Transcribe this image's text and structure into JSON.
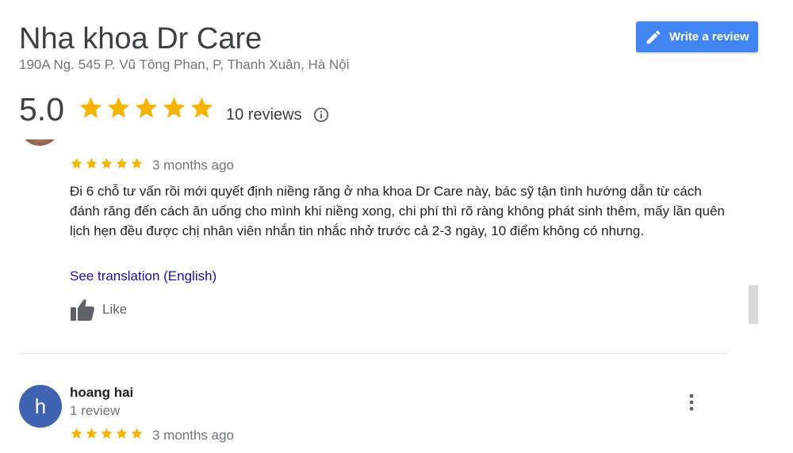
{
  "place": {
    "name": "Nha khoa Dr Care",
    "address": "190A Ng. 545 P. Vũ Tông Phan, P, Thanh Xuân, Hà Nội"
  },
  "write_review": {
    "label": "Write a review"
  },
  "summary": {
    "rating": "5.0",
    "stars": 5,
    "reviews_label": "10 reviews"
  },
  "reviews": [
    {
      "stars": 5,
      "date": "3 months ago",
      "text": "Đi 6 chỗ tư vấn rồi mới quyết định niềng răng ở nha khoa Dr Care này, bác sỹ tận tình hướng dẫn từ cách đánh răng đến cách ăn uống cho mình khi niềng xong, chi phí thì rõ ràng không phát sinh thêm, mấy lần quên lịch hẹn đều được chị nhân viên nhắn tin nhắc nhở trước cả 2-3 ngày, 10 điểm không có nhưng.",
      "translate_label": "See translation (English)",
      "like_label": "Like"
    },
    {
      "author": "hoang hai",
      "avatar_letter": "h",
      "author_meta": "1 review",
      "stars": 5,
      "date": "3 months ago"
    }
  ],
  "colors": {
    "star": "#f4b400",
    "button": "#4285f4",
    "link": "#1a0dab",
    "avatar_h": "#3f63b1"
  },
  "icons": {
    "write": "pencil-icon",
    "info": "info-icon",
    "like": "thumbs-up-icon",
    "more": "more-vert-icon"
  }
}
